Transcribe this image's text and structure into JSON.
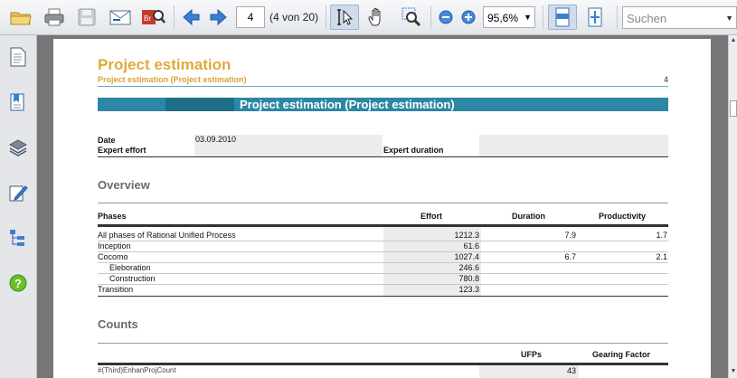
{
  "toolbar": {
    "icons": [
      "open-folder-icon",
      "print-icon",
      "save-icon",
      "email-icon",
      "find-icon",
      "previous-page-icon",
      "next-page-icon",
      "select-text-icon",
      "hand-tool-icon",
      "zoom-tool-icon",
      "zoom-out-icon",
      "zoom-in-icon",
      "fit-width-icon",
      "fit-page-icon"
    ],
    "page_number": "4",
    "page_count": "(4 von 20)",
    "zoom": "95,6%",
    "search_placeholder": "Suchen"
  },
  "sidebar": {
    "icons": [
      "pages-icon",
      "bookmarks-icon",
      "layers-icon",
      "signatures-icon",
      "structure-icon",
      "help-icon"
    ]
  },
  "page": {
    "title": "Project estimation",
    "subtitle": "Project estimation (Project estimation)",
    "number": "4",
    "banner": "Project estimation (Project estimation)",
    "info": {
      "date_label": "Date",
      "date_value": "03.09.2010",
      "effort_label": "Expert effort",
      "duration_label": "Expert duration"
    },
    "overview": {
      "heading": "Overview",
      "headers": [
        "Phases",
        "Effort",
        "Duration",
        "Productivity"
      ],
      "rows": [
        {
          "phase": "All phases of Rational Unified Process",
          "effort": "1212.3",
          "duration": "7.9",
          "productivity": "1.7"
        },
        {
          "phase": "Inception",
          "effort": "61.6",
          "duration": "",
          "productivity": ""
        },
        {
          "phase": "Cocomo",
          "effort": "1027.4",
          "duration": "6.7",
          "productivity": "2.1"
        },
        {
          "phase": "Eleboration",
          "effort": "246.6",
          "duration": "",
          "productivity": ""
        },
        {
          "phase": "Construction",
          "effort": "780.8",
          "duration": "",
          "productivity": ""
        },
        {
          "phase": "Transition",
          "effort": "123.3",
          "duration": "",
          "productivity": ""
        }
      ]
    },
    "counts": {
      "heading": "Counts",
      "headers": [
        "UFPs",
        "Gearing Factor"
      ],
      "rows": [
        {
          "name": "#(Third)EnhanProjCount",
          "ufps": "43"
        }
      ]
    }
  },
  "colors": {
    "title": "#e3a93b",
    "banner": "#2c87a4",
    "shade": "#ececec"
  }
}
